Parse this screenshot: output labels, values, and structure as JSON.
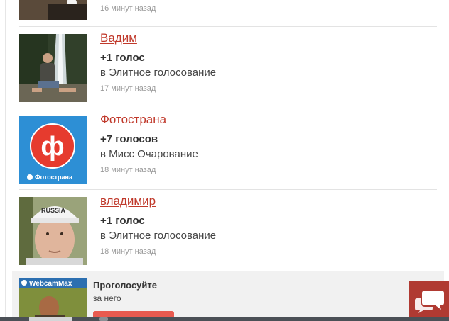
{
  "feed": {
    "items": [
      {
        "time": "16 минут назад",
        "icon": "landscape-photo"
      },
      {
        "name": "Вадим",
        "votes": "+1 голос",
        "contest": "в Элитное голосование",
        "time": "17 минут назад",
        "icon": "waterfall-photo"
      },
      {
        "name": "Фотострана",
        "votes": "+7 голосов",
        "contest": "в Мисс Очарование",
        "time": "18 минут назад",
        "icon": "fotostrana-logo",
        "logo_letter": "ф",
        "logo_caption": "Фотострана"
      },
      {
        "name": "владимир",
        "votes": "+1 голос",
        "contest": "в Элитное голосование",
        "time": "18 минут назад",
        "icon": "portrait-photo",
        "cap_text": "RUSSIA"
      }
    ]
  },
  "promo": {
    "title": "Проголосуйте",
    "subtitle": "за него",
    "avatar_caption": "WebcamMax",
    "icon": "webcam-photo"
  },
  "chat": {
    "icon": "chat-bubbles-icon"
  },
  "colors": {
    "link": "#c0392b",
    "chat_bg": "#b03a32",
    "promo_bg": "#f1f1f1",
    "button": "#e85a4f",
    "logo_blue": "#2d8fd5",
    "logo_red": "#e63b2e"
  }
}
